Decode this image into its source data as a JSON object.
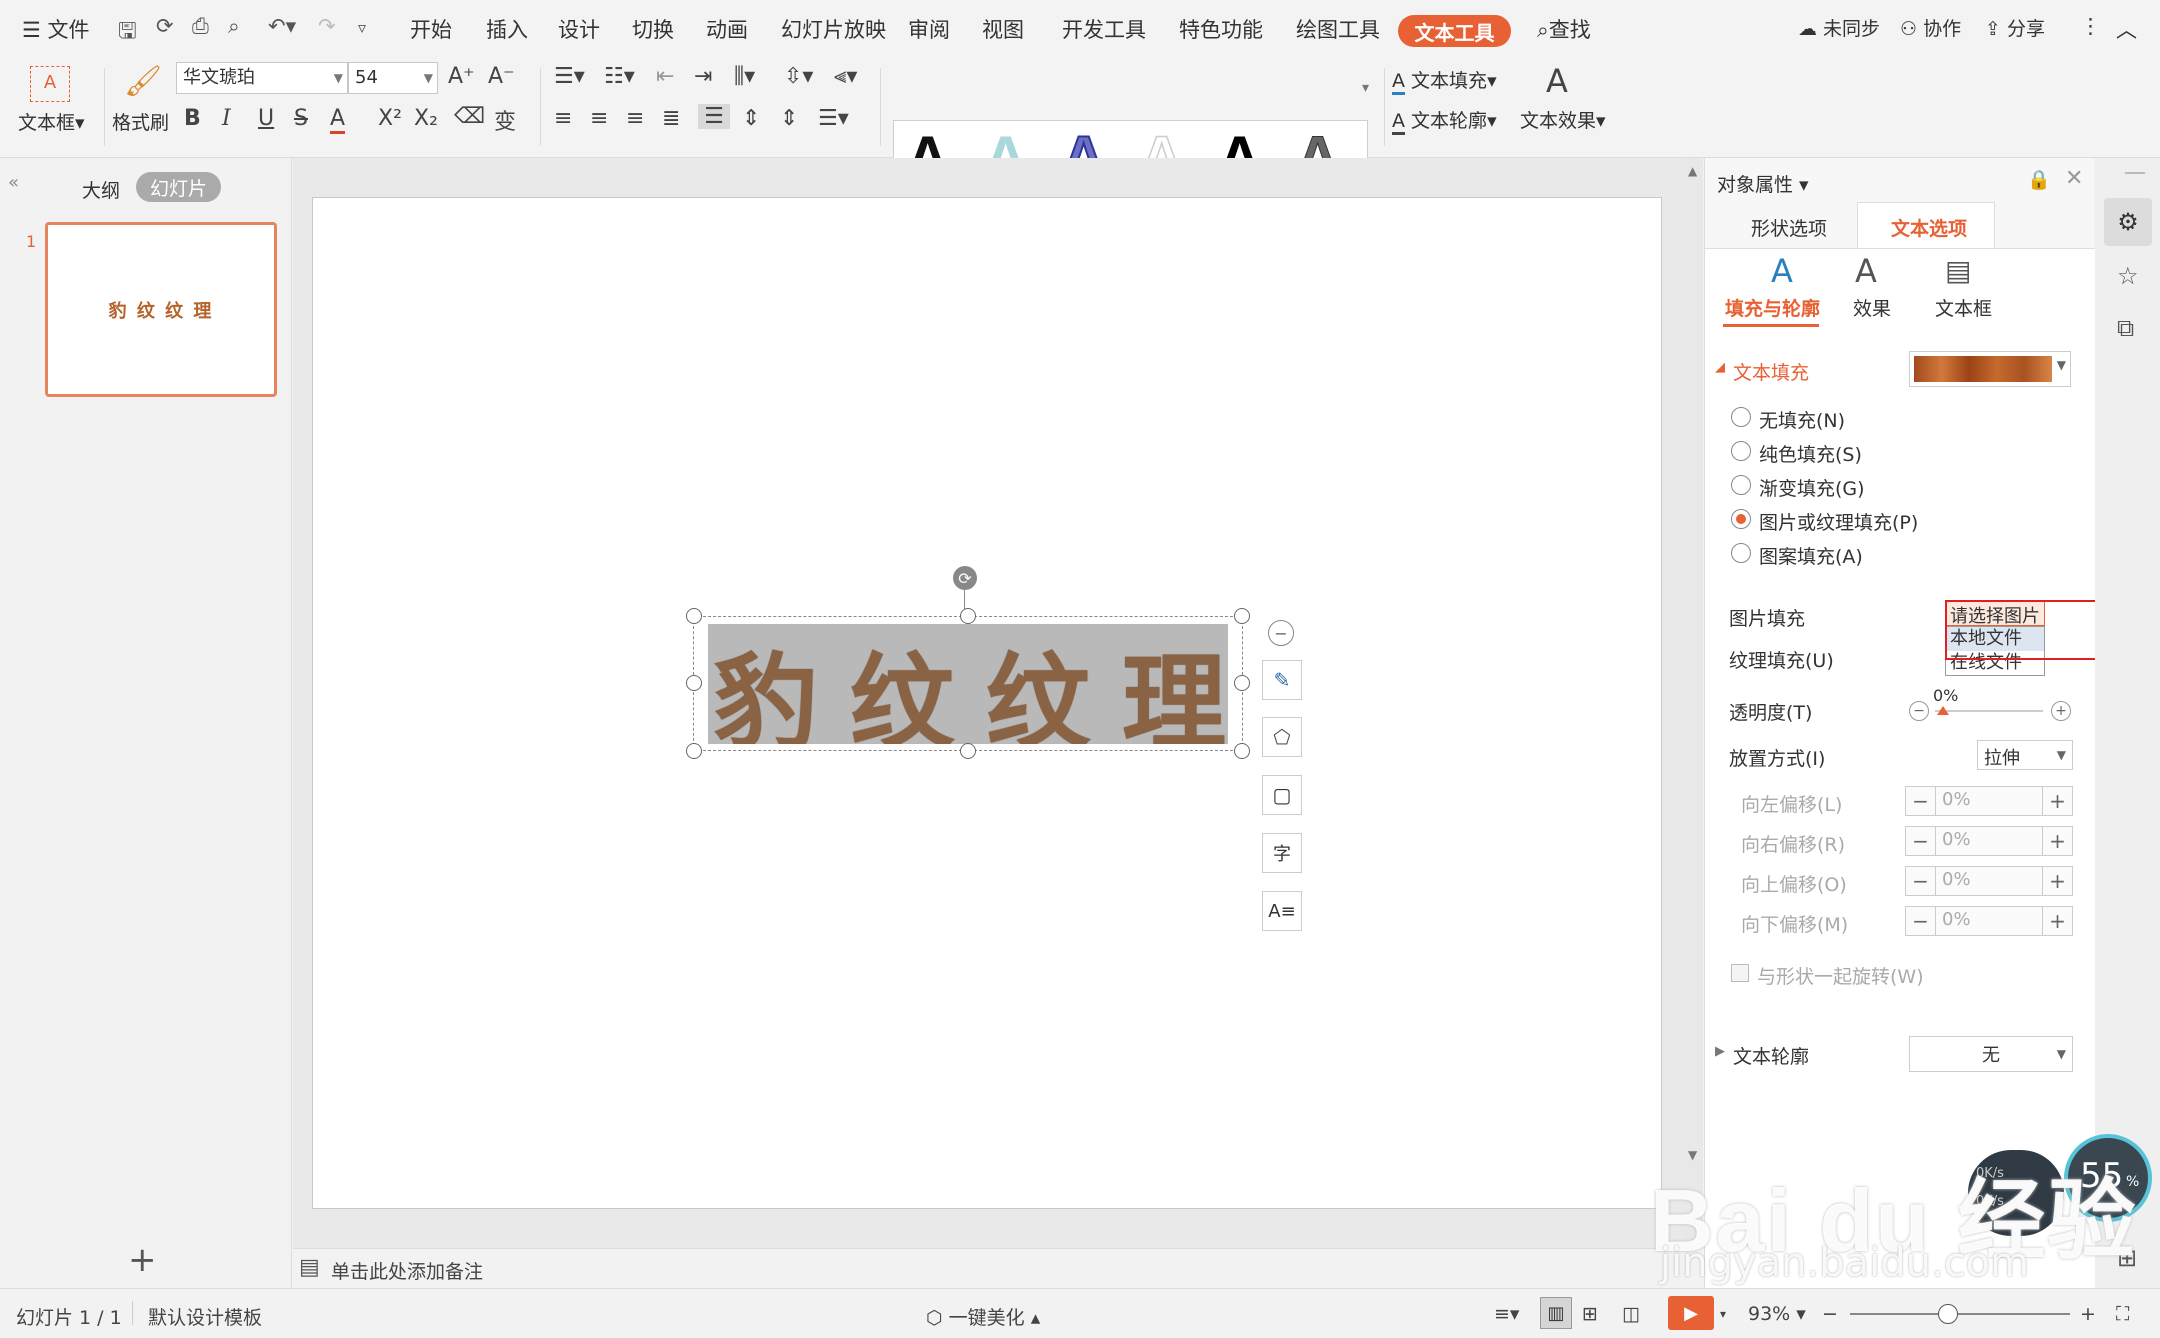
{
  "menubar": {
    "file": "文件",
    "tabs": [
      "开始",
      "插入",
      "设计",
      "切换",
      "动画",
      "幻灯片放映",
      "审阅",
      "视图",
      "开发工具",
      "特色功能",
      "绘图工具"
    ],
    "active_tab": "文本工具",
    "search": "查找",
    "right": {
      "unsync": "未同步",
      "collab": "协作",
      "share": "分享"
    }
  },
  "ribbon": {
    "textbox": "文本框",
    "format_painter": "格式刷",
    "font_name": "华文琥珀",
    "font_size": "54",
    "text_fill": "文本填充",
    "text_outline": "文本轮廓",
    "text_effect": "文本效果",
    "bold": "B",
    "italic": "I",
    "underline": "U",
    "strike": "S",
    "fontcolor": "A"
  },
  "left_panel": {
    "tab_outline": "大纲",
    "tab_slides": "幻灯片",
    "slide_number": "1",
    "thumb_text": "豹 纹 纹 理"
  },
  "slide": {
    "wordart_chars": [
      "豹",
      "纹",
      "纹",
      "理"
    ]
  },
  "notes": {
    "placeholder": "单击此处添加备注"
  },
  "right_panel": {
    "title": "对象属性",
    "tabs": [
      "形状选项",
      "文本选项"
    ],
    "subtabs": [
      "填充与轮廓",
      "效果",
      "文本框"
    ],
    "section_fill": "文本填充",
    "radios": [
      "无填充(N)",
      "纯色填充(S)",
      "渐变填充(G)",
      "图片或纹理填充(P)",
      "图案填充(A)"
    ],
    "selected_radio": 3,
    "picture_fill_label": "图片填充",
    "picture_fill_button": "请选择图片",
    "dropdown_items": [
      "本地文件",
      "在线文件"
    ],
    "texture_fill_label": "纹理填充(U)",
    "transparency_label": "透明度(T)",
    "transparency_value": "0%",
    "placement_label": "放置方式(I)",
    "placement_value": "拉伸",
    "offsets": [
      {
        "label": "向左偏移(L)",
        "value": "0%"
      },
      {
        "label": "向右偏移(R)",
        "value": "0%"
      },
      {
        "label": "向上偏移(O)",
        "value": "0%"
      },
      {
        "label": "向下偏移(M)",
        "value": "0%"
      }
    ],
    "rotate_with_shape": "与形状一起旋转(W)",
    "section_outline": "文本轮廓",
    "outline_value": "无",
    "accent_color": "#e86135"
  },
  "status": {
    "slide_info": "幻灯片 1 / 1",
    "template": "默认设计模板",
    "beautify": "一键美化",
    "zoom": "93%"
  },
  "overlay": {
    "net_percent": "55",
    "net_unit": "%",
    "net_up": "0K/s",
    "net_down": "0K/s",
    "watermark": "Bai du 经验",
    "watermark_url": "jingyan.baidu.com"
  }
}
